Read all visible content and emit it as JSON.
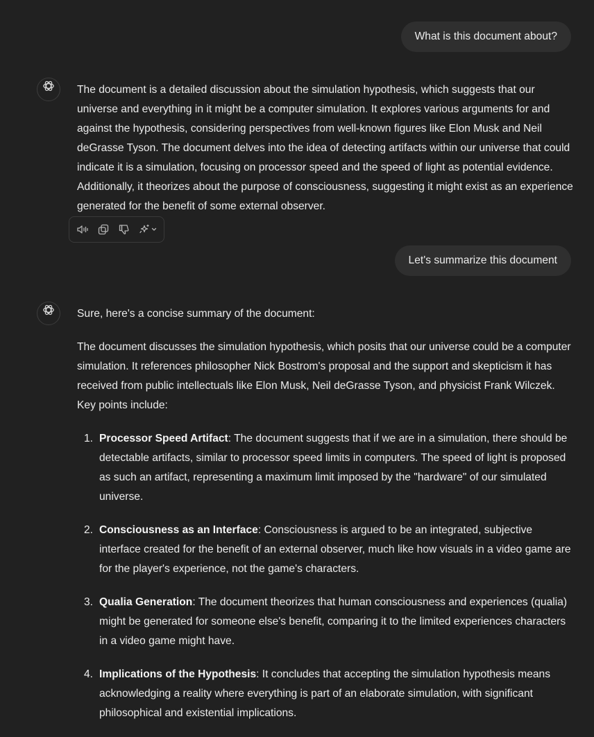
{
  "conversation": {
    "user_messages": [
      "What is this document about?",
      "Let's summarize this document"
    ],
    "first_response": "The document is a detailed discussion about the simulation hypothesis, which suggests that our universe and everything in it might be a computer simulation. It explores various arguments for and against the hypothesis, considering perspectives from well-known figures like Elon Musk and Neil deGrasse Tyson. The document delves into the idea of detecting artifacts within our universe that could indicate it is a simulation, focusing on processor speed and the speed of light as potential evidence. Additionally, it theorizes about the purpose of consciousness, suggesting it might exist as an experience generated for the benefit of some external observer.",
    "second_response": {
      "intro": "Sure, here's a concise summary of the document:",
      "lead": "The document discusses the simulation hypothesis, which posits that our universe could be a computer simulation. It references philosopher Nick Bostrom's proposal and the support and skepticism it has received from public intellectuals like Elon Musk, Neil deGrasse Tyson, and physicist Frank Wilczek. Key points include:",
      "points": [
        {
          "num": "1.",
          "title": "Processor Speed Artifact",
          "text": ": The document suggests that if we are in a simulation, there should be detectable artifacts, similar to processor speed limits in computers. The speed of light is proposed as such an artifact, representing a maximum limit imposed by the \"hardware\" of our simulated universe."
        },
        {
          "num": "2.",
          "title": "Consciousness as an Interface",
          "text": ": Consciousness is argued to be an integrated, subjective interface created for the benefit of an external observer, much like how visuals in a video game are for the player's experience, not the game's characters."
        },
        {
          "num": "3.",
          "title": "Qualia Generation",
          "text": ": The document theorizes that human consciousness and experiences (qualia) might be generated for someone else's benefit, comparing it to the limited experiences characters in a video game might have."
        },
        {
          "num": "4.",
          "title": "Implications of the Hypothesis",
          "text": ": It concludes that accepting the simulation hypothesis means acknowledging a reality where everything is part of an elaborate simulation, with significant philosophical and existential implications."
        }
      ]
    }
  },
  "icons": {
    "avatar": "openai-logo-icon",
    "actions": [
      "read-aloud-icon",
      "copy-icon",
      "thumbs-down-icon",
      "regenerate-sparkle-icon",
      "chevron-down-icon"
    ]
  },
  "colors": {
    "background": "#212121",
    "user_bubble": "#2f2f2f",
    "text": "#ececec",
    "icon": "#b4b4b4"
  }
}
